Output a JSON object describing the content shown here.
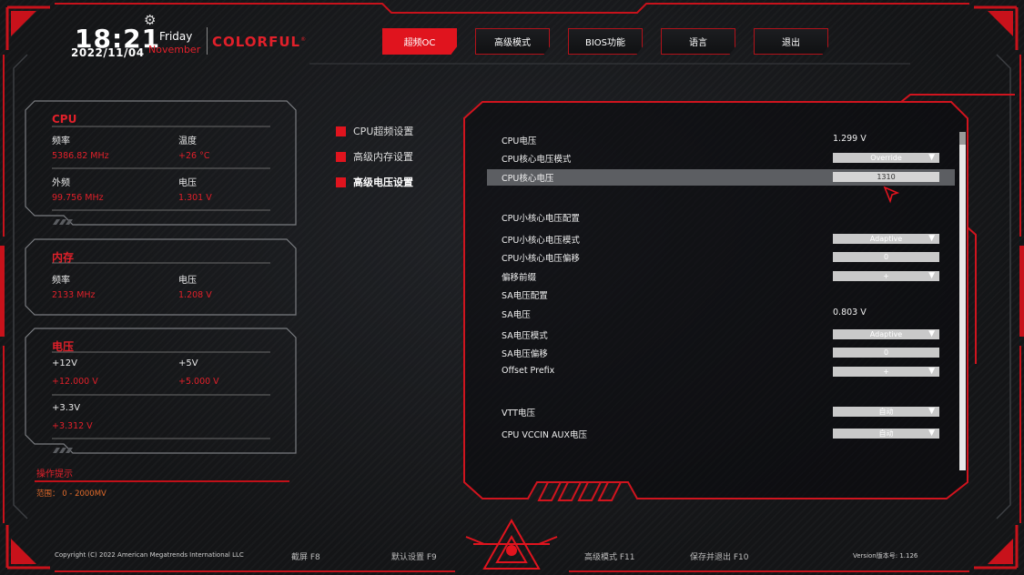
{
  "header": {
    "time": "18:21",
    "date": "2022/11/04",
    "weekday": "Friday",
    "month": "November",
    "brand": "COLORFUL",
    "brand_mark": "®"
  },
  "nav": {
    "tabs": [
      {
        "label": "超频OC",
        "active": true
      },
      {
        "label": "高级模式",
        "active": false
      },
      {
        "label": "BIOS功能",
        "active": false
      },
      {
        "label": "语言",
        "active": false
      },
      {
        "label": "退出",
        "active": false
      }
    ]
  },
  "cpu_panel": {
    "title": "CPU",
    "freq_label": "频率",
    "freq_value": "5386.82 MHz",
    "temp_label": "温度",
    "temp_value": "+26 °C",
    "bclk_label": "外频",
    "bclk_value": "99.756 MHz",
    "volt_label": "电压",
    "volt_value": "1.301 V"
  },
  "memory_panel": {
    "title": "内存",
    "freq_label": "频率",
    "freq_value": "2133 MHz",
    "volt_label": "电压",
    "volt_value": "1.208 V"
  },
  "voltage_panel": {
    "title": "电压",
    "v12_label": "+12V",
    "v12_value": "+12.000 V",
    "v5_label": "+5V",
    "v5_value": "+5.000 V",
    "v33_label": "+3.3V",
    "v33_value": "+3.312 V"
  },
  "hint": {
    "title": "操作提示",
    "range": "范围： 0 - 2000MV"
  },
  "side_menu": {
    "items": [
      {
        "label": "CPU超频设置",
        "active": false
      },
      {
        "label": "高级内存设置",
        "active": false
      },
      {
        "label": "高级电压设置",
        "active": true
      }
    ]
  },
  "settings": {
    "rows": [
      {
        "name": "CPU电压",
        "value": "1.299 V"
      },
      {
        "name": "CPU核心电压模式",
        "control": "Override"
      },
      {
        "name": "CPU核心电压",
        "input": "1310"
      },
      {
        "name": "CPU小核心电压配置"
      },
      {
        "name": "CPU小核心电压模式",
        "control": "Adaptive"
      },
      {
        "name": "CPU小核心电压偏移",
        "input": "0"
      },
      {
        "name": "偏移前缀",
        "control": "+"
      },
      {
        "name": "SA电压配置"
      },
      {
        "name": "SA电压",
        "value": "0.803 V"
      },
      {
        "name": "SA电压模式",
        "control": "Adaptive"
      },
      {
        "name": "SA电压偏移",
        "input": "0"
      },
      {
        "name": "Offset Prefix",
        "control": "+"
      },
      {
        "name": "VTT电压",
        "control": "自动"
      },
      {
        "name": "CPU VCCIN AUX电压",
        "control": "自动"
      }
    ]
  },
  "footer": {
    "copyright": "Copyright (C) 2022 American Megatrends International LLC",
    "screenshot": "截屏 F8",
    "defaults": "默认设置 F9",
    "advanced": "高级模式 F11",
    "save_exit": "保存并退出 F10",
    "version": "Version版本号: 1.126"
  }
}
